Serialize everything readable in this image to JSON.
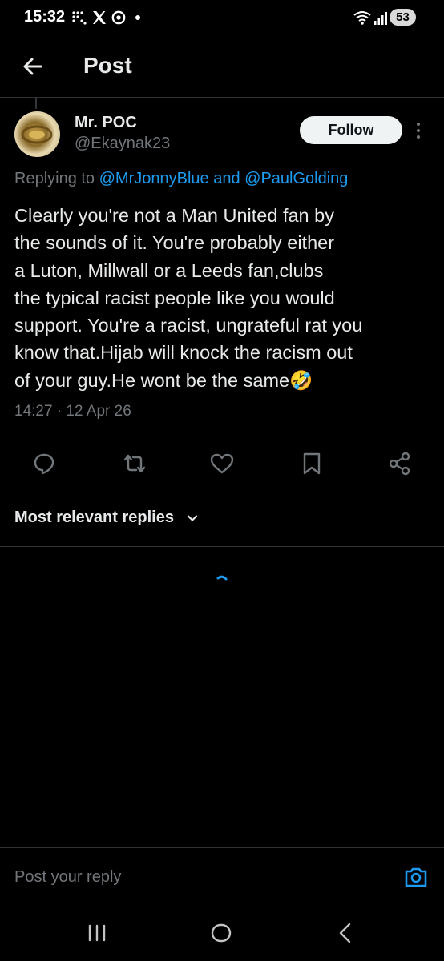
{
  "status_bar": {
    "time": "15:32",
    "battery": "53"
  },
  "header": {
    "title": "Post"
  },
  "post": {
    "author_name": "Mr. POC",
    "author_handle": "@Ekaynak23",
    "follow_label": "Follow",
    "replying_prefix": "Replying to ",
    "replying_user1": "@MrJonnyBlue",
    "replying_and": " and ",
    "replying_user2": "@PaulGolding",
    "text_lines": [
      "Clearly you're not a Man United fan by",
      "the sounds of it. You're probably either",
      "a Luton, Millwall or a Leeds fan,clubs",
      "the typical racist people like you would",
      "support. You're a racist, ungrateful rat you",
      "know that.Hijab will knock the racism out",
      "of your guy.He wont be the same🤣"
    ],
    "timestamp": "14:27 · 12 Apr 26"
  },
  "replies": {
    "sort_label": "Most relevant replies"
  },
  "composer": {
    "placeholder": "Post your reply"
  },
  "colors": {
    "background": "#000000",
    "text": "#e7e9ea",
    "muted": "#71767b",
    "accent": "#1d9bf0",
    "divider": "#2f3336"
  },
  "icons": {
    "back": "arrow-left-icon",
    "more": "more-vertical-icon",
    "reply": "reply-icon",
    "repost": "repost-icon",
    "like": "heart-icon",
    "bookmark": "bookmark-icon",
    "share": "share-icon",
    "chevron": "chevron-down-icon",
    "camera": "camera-icon"
  }
}
